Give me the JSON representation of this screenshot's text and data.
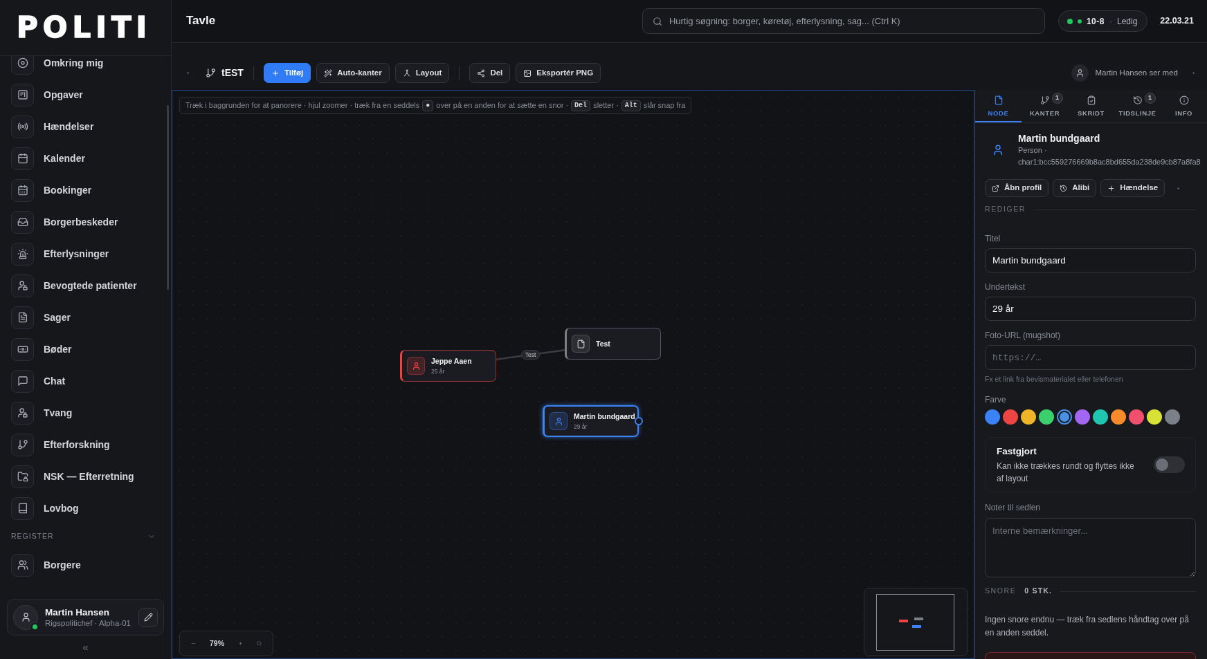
{
  "sidebar": {
    "logo": "POLITI",
    "items": [
      {
        "label": "Omkring mig"
      },
      {
        "label": "Opgaver"
      },
      {
        "label": "Hændelser"
      },
      {
        "label": "Kalender"
      },
      {
        "label": "Bookinger"
      },
      {
        "label": "Borgerbeskeder"
      },
      {
        "label": "Efterlysninger"
      },
      {
        "label": "Bevogtede patienter"
      },
      {
        "label": "Sager"
      },
      {
        "label": "Bøder"
      },
      {
        "label": "Chat"
      },
      {
        "label": "Tvang"
      },
      {
        "label": "Efterforskning"
      },
      {
        "label": "NSK — Efterretning"
      },
      {
        "label": "Lovbog"
      }
    ],
    "sections": [
      {
        "title": "REGISTER",
        "expanded": true,
        "items": [
          {
            "label": "Borgere"
          }
        ]
      }
    ],
    "user": {
      "name": "Martin Hansen",
      "role": "Rigspolitichef · Alpha-01",
      "online": true
    },
    "collapse": "«"
  },
  "header": {
    "title": "Tavle",
    "search": {
      "placeholder": "Hurtig søgning: borger, køretøj, efterlysning, sag... (Ctrl K)"
    },
    "status": {
      "code": "10-8",
      "separator": "·",
      "label": "Ledig"
    },
    "date": "22.03.21"
  },
  "toolbar": {
    "board": "tEST",
    "groups": [
      [
        {
          "label": "Tilføj",
          "kind": "primary"
        },
        {
          "label": "Auto-kanter",
          "kind": "secondary"
        },
        {
          "label": "Layout",
          "kind": "secondary"
        }
      ],
      [
        {
          "label": "Del",
          "kind": "secondary"
        },
        {
          "label": "Eksportér PNG",
          "kind": "secondary"
        }
      ]
    ],
    "viewers": "Martin Hansen ser med"
  },
  "canvas": {
    "hint": [
      {
        "kind": "text",
        "text": "Træk i baggrunden for at panorere · hjul zoomer · træk fra en seddels"
      },
      {
        "kind": "key",
        "text": "●"
      },
      {
        "kind": "text",
        "text": "over på en anden for at sætte en snor ·"
      },
      {
        "kind": "key",
        "text": "Del"
      },
      {
        "kind": "text",
        "text": "sletter ·"
      },
      {
        "kind": "key",
        "text": "Alt"
      },
      {
        "kind": "text",
        "text": "slår snap fra"
      }
    ],
    "nodes": [
      {
        "kind": "person",
        "title": "Jeppe Aaen",
        "subtitle": "25 år",
        "color": "#ef4444",
        "selected": false
      },
      {
        "kind": "document",
        "title": "Test",
        "color": "#7b7f87",
        "selected": false
      },
      {
        "kind": "person",
        "title": "Martin bundgaard",
        "subtitle": "29 år",
        "color": "#3b82f6",
        "selected": true
      }
    ],
    "edges": [
      {
        "label": "Test"
      }
    ],
    "zoom": "79%"
  },
  "panel": {
    "tabs": [
      {
        "label": "NODE",
        "selected": true
      },
      {
        "label": "KANTER",
        "badge": "1",
        "selected": false
      },
      {
        "label": "SKRIDT",
        "selected": false
      },
      {
        "label": "TIDSLINJE",
        "badge": "1",
        "selected": false
      },
      {
        "label": "INFO",
        "selected": false
      }
    ],
    "node": {
      "kind": "person",
      "title": "Martin bundgaard",
      "meta": "Person · char1:bcc559276669b8ac8bd655da238de9cb87a8fa8"
    },
    "actions": [
      {
        "label": "Åbn profil"
      },
      {
        "label": "Alibi"
      },
      {
        "label": "Hændelse"
      }
    ],
    "edit_section": "REDIGER",
    "fields": [
      {
        "kind": "text",
        "label": "Titel",
        "value": "Martin bundgaard"
      },
      {
        "kind": "text",
        "label": "Undertekst",
        "value": "29 år"
      },
      {
        "kind": "mono",
        "label": "Foto-URL (mugshot)",
        "placeholder": "https://…",
        "help": "Fx et link fra bevismaterialet eller telefonen"
      }
    ],
    "color_label": "Farve",
    "colors": [
      {
        "color": "#3b82f6",
        "selected": false
      },
      {
        "color": "#ef4444",
        "selected": false
      },
      {
        "color": "#f0b429",
        "selected": false
      },
      {
        "color": "#3ccf6e",
        "selected": false
      },
      {
        "color": "#4a90e2",
        "selected": true
      },
      {
        "color": "#a366f0",
        "selected": false
      },
      {
        "color": "#20c5b0",
        "selected": false
      },
      {
        "color": "#f78a2b",
        "selected": false
      },
      {
        "color": "#f0506e",
        "selected": false
      },
      {
        "color": "#d8e236",
        "selected": false
      },
      {
        "color": "#7b7f87",
        "selected": false
      }
    ],
    "pinned": {
      "title": "Fastgjort",
      "description": "Kan ikke trækkes rundt og flyttes ikke af layout",
      "on": false
    },
    "notes": {
      "label": "Noter til sedlen",
      "placeholder": "Interne bemærkninger..."
    },
    "strings": {
      "title": "SNORE",
      "count": "0 STK.",
      "empty": "Ingen snore endnu — træk fra sedlens håndtag over på en anden seddel."
    }
  }
}
